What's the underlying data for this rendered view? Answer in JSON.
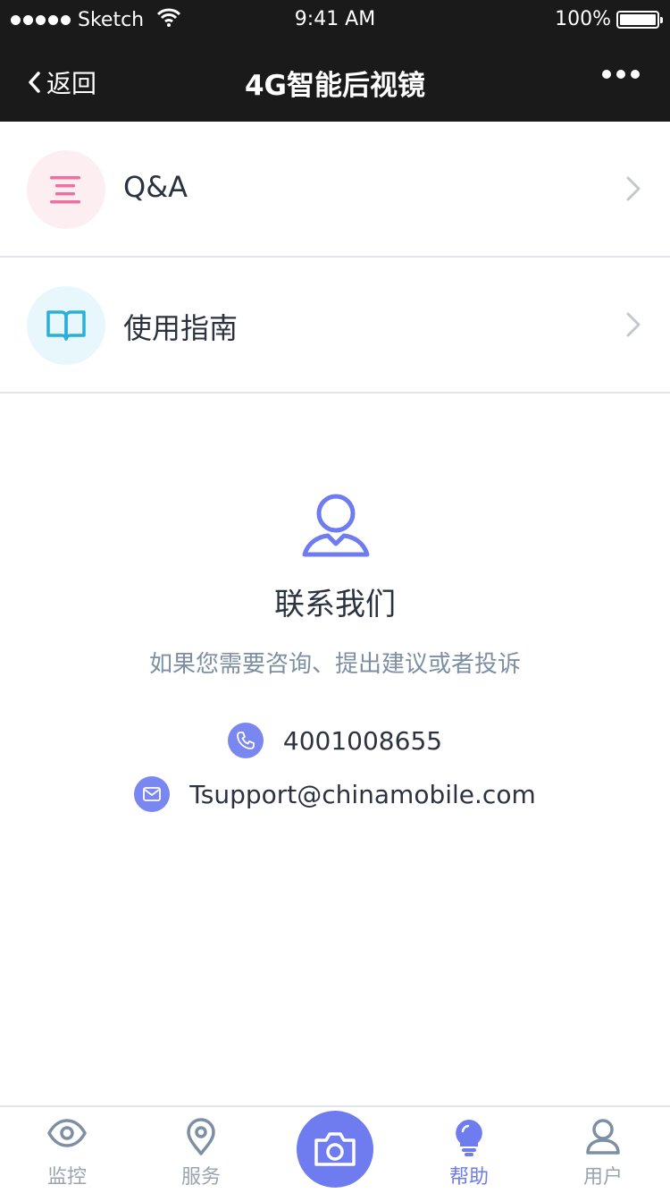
{
  "status_bar": {
    "carrier": "Sketch",
    "time": "9:41 AM",
    "battery": "100%"
  },
  "nav": {
    "back_label": "返回",
    "title": "4G智能后视镜",
    "more_icon": "more-dots-icon"
  },
  "menu": {
    "items": [
      {
        "label": "Q&A",
        "icon": "qa-list-icon",
        "icon_color": "#f06fa0",
        "icon_bg": "#fdeef2"
      },
      {
        "label": "使用指南",
        "icon": "book-icon",
        "icon_color": "#2ab0d8",
        "icon_bg": "#e8f7fb"
      }
    ]
  },
  "contact": {
    "title": "联系我们",
    "subtitle": "如果您需要咨询、提出建议或者投诉",
    "phone": "4001008655",
    "email": "Tsupport@chinamobile.com"
  },
  "tabbar": {
    "items": [
      {
        "label": "监控",
        "icon": "eye-icon",
        "active": false
      },
      {
        "label": "服务",
        "icon": "location-pin-icon",
        "active": false
      },
      {
        "label": "",
        "icon": "camera-icon",
        "active": false
      },
      {
        "label": "帮助",
        "icon": "lightbulb-icon",
        "active": true
      },
      {
        "label": "用户",
        "icon": "user-icon",
        "active": false
      }
    ]
  },
  "colors": {
    "accent": "#6e7cf0",
    "nav_bg": "#1a1a1a",
    "muted_text": "#7d8fa3",
    "inactive_tab": "#9aa5b1"
  }
}
